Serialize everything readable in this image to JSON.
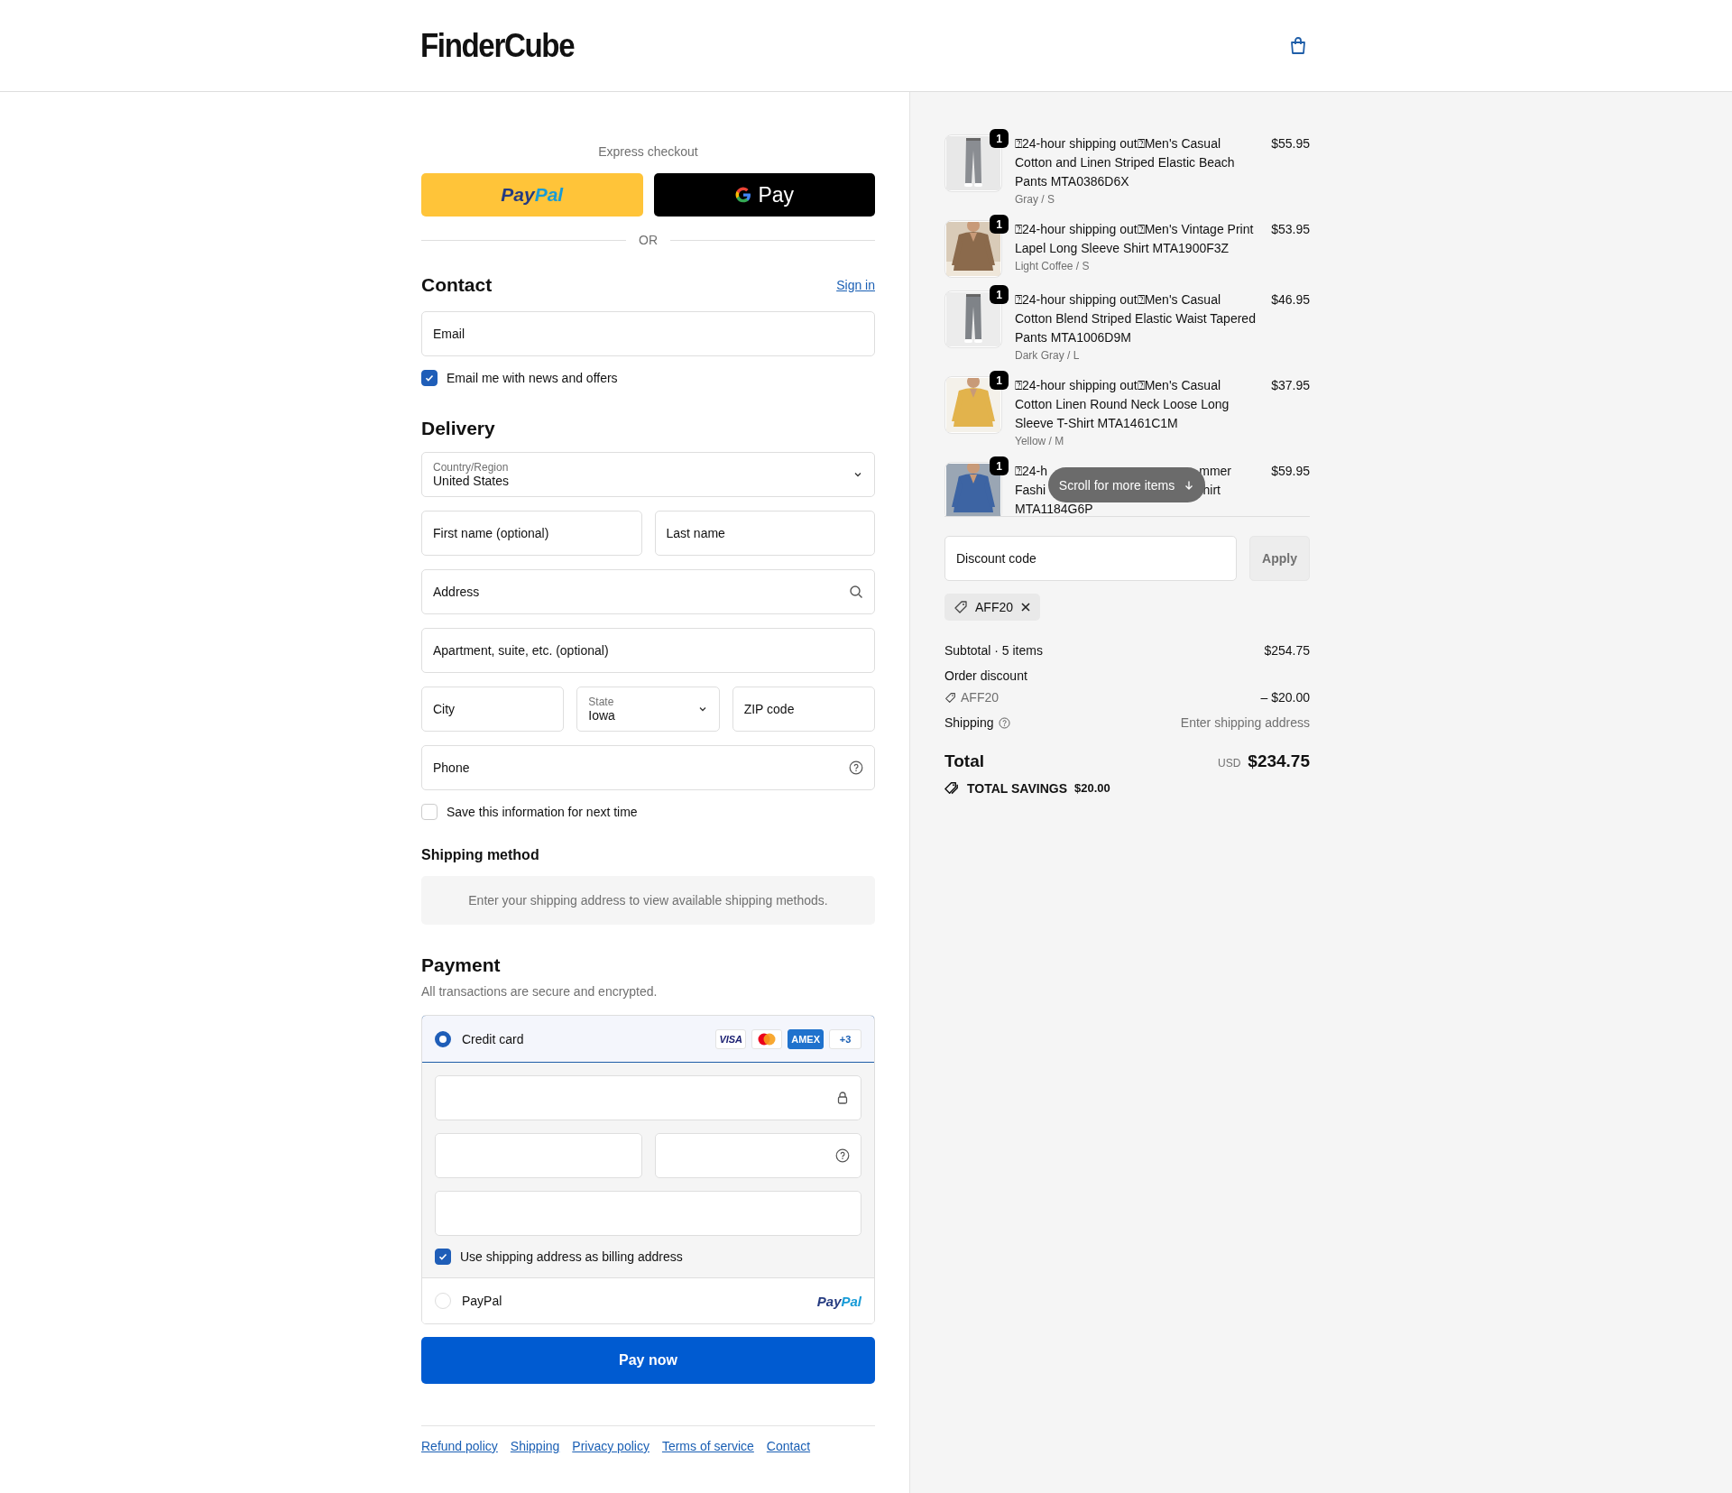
{
  "header": {
    "logo": "FinderCube"
  },
  "express": {
    "title": "Express checkout",
    "buttons": [
      {
        "kind": "paypal",
        "label_a": "Pay",
        "label_b": "Pal"
      },
      {
        "kind": "gpay",
        "label": "Pay"
      }
    ],
    "divider": "OR"
  },
  "contact": {
    "title": "Contact",
    "sign_in": "Sign in",
    "email": {
      "placeholder": "Email"
    },
    "newsletter": {
      "label": "Email me with news and offers",
      "checked": true
    }
  },
  "delivery": {
    "title": "Delivery",
    "rows": [
      [
        {
          "kind": "select",
          "label": "Country/Region",
          "value": "United States"
        }
      ],
      [
        {
          "kind": "text",
          "placeholder": "First name (optional)"
        },
        {
          "kind": "text",
          "placeholder": "Last name"
        }
      ],
      [
        {
          "kind": "text",
          "placeholder": "Address"
        }
      ],
      [
        {
          "kind": "text",
          "placeholder": "Apartment, suite, etc. (optional)"
        }
      ],
      [
        {
          "kind": "text",
          "placeholder": "City"
        },
        {
          "kind": "select",
          "label": "State",
          "value": "Iowa"
        },
        {
          "kind": "text",
          "placeholder": "ZIP code"
        }
      ],
      [
        {
          "kind": "text",
          "placeholder": "Phone"
        }
      ]
    ],
    "save_info": {
      "label": "Save this information for next time",
      "checked": false
    }
  },
  "shipping_method": {
    "title": "Shipping method",
    "message": "Enter your shipping address to view available shipping methods."
  },
  "payment": {
    "title": "Payment",
    "subtitle": "All transactions are secure and encrypted.",
    "methods": [
      {
        "kind": "card",
        "label": "Credit card",
        "selected": true,
        "brands": [
          {
            "kind": "visa",
            "label": "VISA"
          },
          {
            "kind": "mastercard"
          },
          {
            "kind": "amex",
            "label": "AMEX"
          },
          {
            "kind": "more",
            "label": "+3"
          }
        ],
        "billing": {
          "label": "Use shipping address as billing address",
          "checked": true
        }
      },
      {
        "kind": "paypal",
        "label": "PayPal",
        "selected": false,
        "logo_a": "Pay",
        "logo_b": "Pal"
      }
    ],
    "pay_button": "Pay now"
  },
  "footer_links": [
    "Refund policy",
    "Shipping",
    "Privacy policy",
    "Terms of service",
    "Contact"
  ],
  "summary": {
    "items": [
      {
        "quantity": "1",
        "title_lines": [
          [
            "⍰24-hour shipping out⍰Men's Casual Cotton and Linen Striped Elastic Beach Pants MTA0386D6X"
          ]
        ],
        "variant": "Gray / S",
        "price": "$55.95"
      },
      {
        "quantity": "1",
        "title_lines": [
          [
            "⍰24-hour shipping out⍰Men's Vintage Print Lapel Long Sleeve Shirt MTA1900F3Z"
          ]
        ],
        "variant": "Light Coffee / S",
        "price": "$53.95"
      },
      {
        "quantity": "1",
        "title_lines": [
          [
            "⍰24-hour shipping out⍰Men's Casual Cotton Blend Striped Elastic Waist Tapered Pants MTA1006D9M"
          ]
        ],
        "variant": "Dark Gray / L",
        "price": "$46.95"
      },
      {
        "quantity": "1",
        "title_lines": [
          [
            "⍰24-hour shipping out⍰Men's Casual Cotton Linen Round Neck Loose Long Sleeve T-Shirt MTA1461C1M"
          ]
        ],
        "variant": "Yellow / M",
        "price": "$37.95"
      },
      {
        "quantity": "1",
        "title_lines": [
          [
            "⍰24-h",
            "mmer"
          ],
          [
            "Fashi",
            "hirt"
          ],
          [
            "MTA1184G6P"
          ]
        ],
        "price": "$59.95"
      }
    ],
    "scroll_hint": "Scroll for more items",
    "discount": {
      "placeholder": "Discount code",
      "button": "Apply"
    },
    "applied_code": "AFF20",
    "subtotal": {
      "label": "Subtotal · 5 items",
      "value": "$254.75"
    },
    "order_discount": {
      "label": "Order discount",
      "code": "AFF20",
      "value": "– $20.00"
    },
    "shipping": {
      "label": "Shipping",
      "value": "Enter shipping address"
    },
    "total": {
      "label": "Total",
      "currency": "USD",
      "value": "$234.75"
    },
    "savings": {
      "label": "TOTAL SAVINGS",
      "value": "$20.00"
    }
  }
}
